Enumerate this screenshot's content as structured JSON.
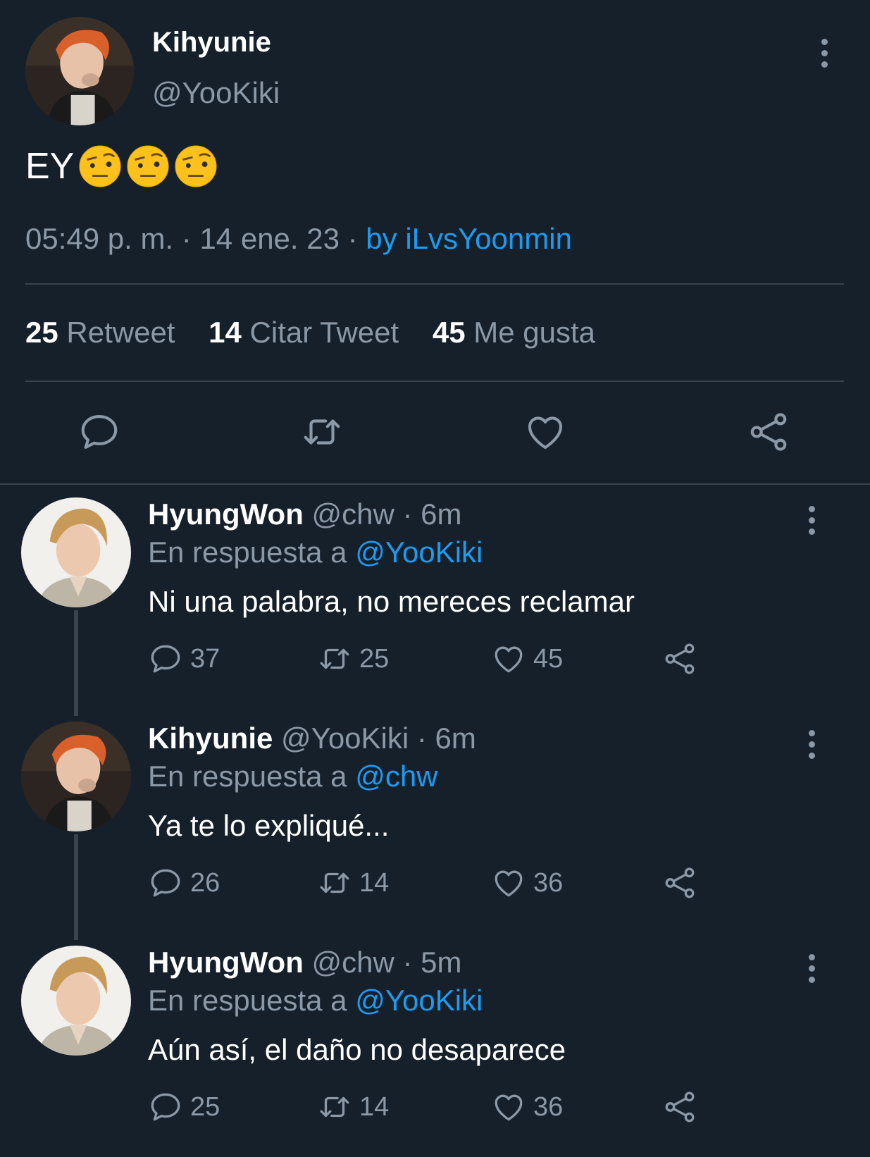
{
  "main": {
    "name": "Kihyunie",
    "handle": "@YooKiki",
    "text": "EY",
    "emoji": [
      "face-with-raised-eyebrow",
      "face-with-raised-eyebrow",
      "face-with-raised-eyebrow"
    ],
    "time": "05:49 p. m. · 14 ene. 23 · ",
    "source": "by iLvsYoonmin",
    "stats": {
      "retweets_count": "25",
      "retweets_label": "Retweet",
      "quotes_count": "14",
      "quotes_label": "Citar Tweet",
      "likes_count": "45",
      "likes_label": "Me gusta"
    }
  },
  "replies": [
    {
      "name": "HyungWon",
      "handle": "@chw · 6m",
      "reply_prefix": "En respuesta a ",
      "reply_to": "@YooKiki",
      "text": "Ni una palabra, no mereces reclamar",
      "replies": "37",
      "retweets": "25",
      "likes": "45"
    },
    {
      "name": "Kihyunie",
      "handle": "@YooKiki · 6m",
      "reply_prefix": "En respuesta a ",
      "reply_to": "@chw",
      "text": "Ya te lo expliqué...",
      "replies": "26",
      "retweets": "14",
      "likes": "36"
    },
    {
      "name": "HyungWon",
      "handle": "@chw · 5m",
      "reply_prefix": "En respuesta a ",
      "reply_to": "@YooKiki",
      "text": "Aún así, el daño no desaparece",
      "replies": "25",
      "retweets": "14",
      "likes": "36"
    }
  ],
  "colors": {
    "background": "#15202b",
    "accent": "#1d9bf0",
    "muted": "#8b98a5",
    "divider": "#38444d"
  }
}
